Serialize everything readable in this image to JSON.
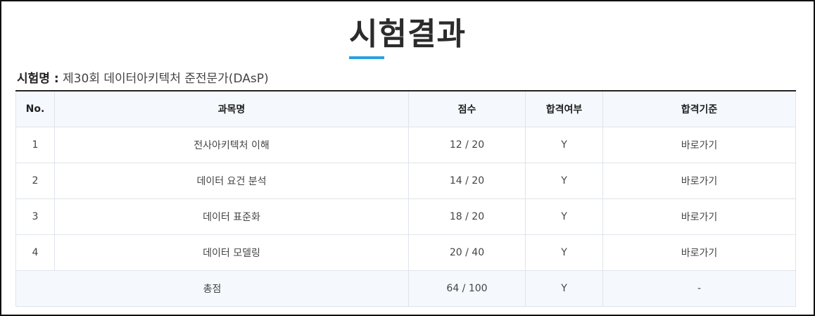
{
  "page": {
    "title": "시험결과"
  },
  "exam": {
    "label": "시험명 :",
    "name": "제30회 데이터아키텍처 준전문가(DAsP)"
  },
  "table": {
    "headers": {
      "no": "No.",
      "subject": "과목명",
      "score": "점수",
      "pass": "합격여부",
      "criteria": "합격기준"
    },
    "rows": [
      {
        "no": "1",
        "subject": "전사아키텍처 이해",
        "score": "12 / 20",
        "pass": "Y",
        "criteria": "바로가기"
      },
      {
        "no": "2",
        "subject": "데이터 요건 분석",
        "score": "14 / 20",
        "pass": "Y",
        "criteria": "바로가기"
      },
      {
        "no": "3",
        "subject": "데이터 표준화",
        "score": "18 / 20",
        "pass": "Y",
        "criteria": "바로가기"
      },
      {
        "no": "4",
        "subject": "데이터 모델링",
        "score": "20 / 40",
        "pass": "Y",
        "criteria": "바로가기"
      }
    ],
    "total": {
      "label": "총점",
      "score": "64 / 100",
      "pass": "Y",
      "criteria": "-"
    }
  },
  "colors": {
    "accent": "#2aa0e0",
    "header_bg": "#f5f9fd",
    "border": "#dfe4ea",
    "frame": "#111111"
  }
}
